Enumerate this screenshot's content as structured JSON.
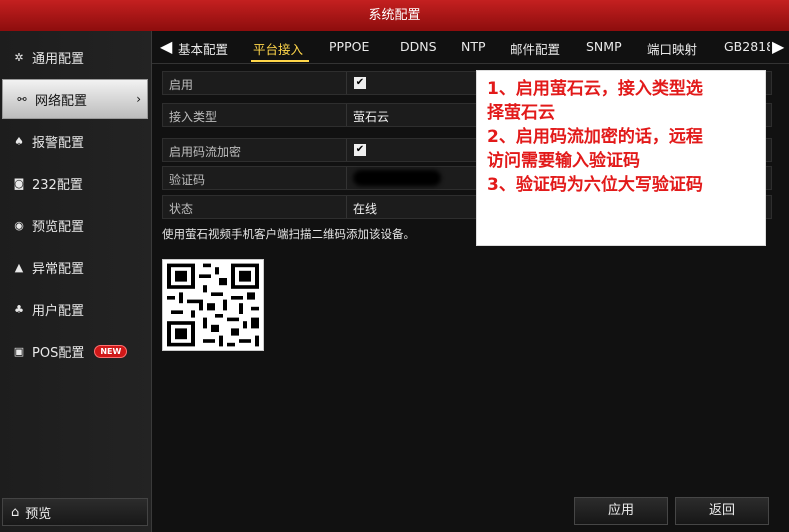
{
  "window": {
    "title": "系统配置"
  },
  "sidebar": {
    "items": [
      {
        "label": "通用配置",
        "icon": "gear-icon",
        "glyph": "✲"
      },
      {
        "label": "网络配置",
        "icon": "network-icon",
        "glyph": "⚯"
      },
      {
        "label": "报警配置",
        "icon": "alarm-icon",
        "glyph": "♠"
      },
      {
        "label": "232配置",
        "icon": "serial-port-icon",
        "glyph": "◙"
      },
      {
        "label": "预览配置",
        "icon": "eye-icon",
        "glyph": "◉"
      },
      {
        "label": "异常配置",
        "icon": "warning-icon",
        "glyph": "▲"
      },
      {
        "label": "用户配置",
        "icon": "users-icon",
        "glyph": "♣"
      },
      {
        "label": "POS配置",
        "icon": "pos-icon",
        "glyph": "▣",
        "badge": "NEW"
      }
    ],
    "active_index": 1,
    "preview_label": "预览"
  },
  "tabs": {
    "items": [
      "基本配置",
      "平台接入",
      "PPPOE",
      "DDNS",
      "NTP",
      "邮件配置",
      "SNMP",
      "端口映射",
      "GB2818"
    ],
    "active_index": 1
  },
  "form": {
    "enable": {
      "label": "启用",
      "checked": true
    },
    "access_type": {
      "label": "接入类型",
      "value": "萤石云"
    },
    "stream_encryption": {
      "label": "启用码流加密",
      "checked": true
    },
    "verify_code": {
      "label": "验证码",
      "value_hidden": true
    },
    "status": {
      "label": "状态",
      "value": "在线"
    }
  },
  "hint_text": "使用萤石视频手机客户端扫描二维码添加该设备。",
  "annotation": {
    "lines": [
      "1、启用萤石云，接入类型选",
      "择萤石云",
      "2、启用码流加密的话，远程",
      "访问需要输入验证码",
      "3、验证码为六位大写验证码"
    ],
    "color": "#e21a1a"
  },
  "buttons": {
    "apply": "应用",
    "back": "返回"
  },
  "colors": {
    "title_bar": "#b51818",
    "active_tab": "#ffd64a",
    "new_badge": "#d01818"
  }
}
